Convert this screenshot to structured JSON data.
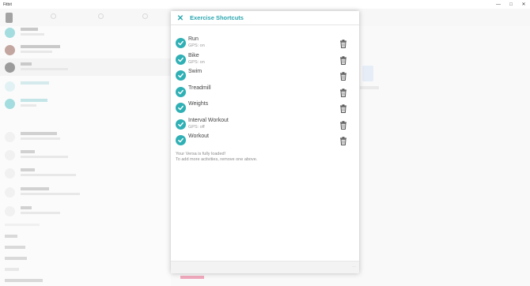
{
  "window": {
    "title": "Fitbit"
  },
  "dialog": {
    "title": "Exercise Shortcuts",
    "shortcuts": [
      {
        "name": "Run",
        "sub": "GPS: on"
      },
      {
        "name": "Bike",
        "sub": "GPS: on"
      },
      {
        "name": "Swim",
        "sub": ""
      },
      {
        "name": "Treadmill",
        "sub": ""
      },
      {
        "name": "Weights",
        "sub": ""
      },
      {
        "name": "Interval Workout",
        "sub": "GPS: off"
      },
      {
        "name": "Workout",
        "sub": ""
      }
    ],
    "info_line1": "Your Versa is fully loaded!",
    "info_line2": "To add more activities, remove one above."
  },
  "colors": {
    "accent": "#2aa7b0",
    "check": "#2fb0b5",
    "bottom_link": "#e0446e"
  },
  "icons": {
    "close": "close-icon",
    "check": "checkmark-icon",
    "delete": "trash-icon"
  }
}
